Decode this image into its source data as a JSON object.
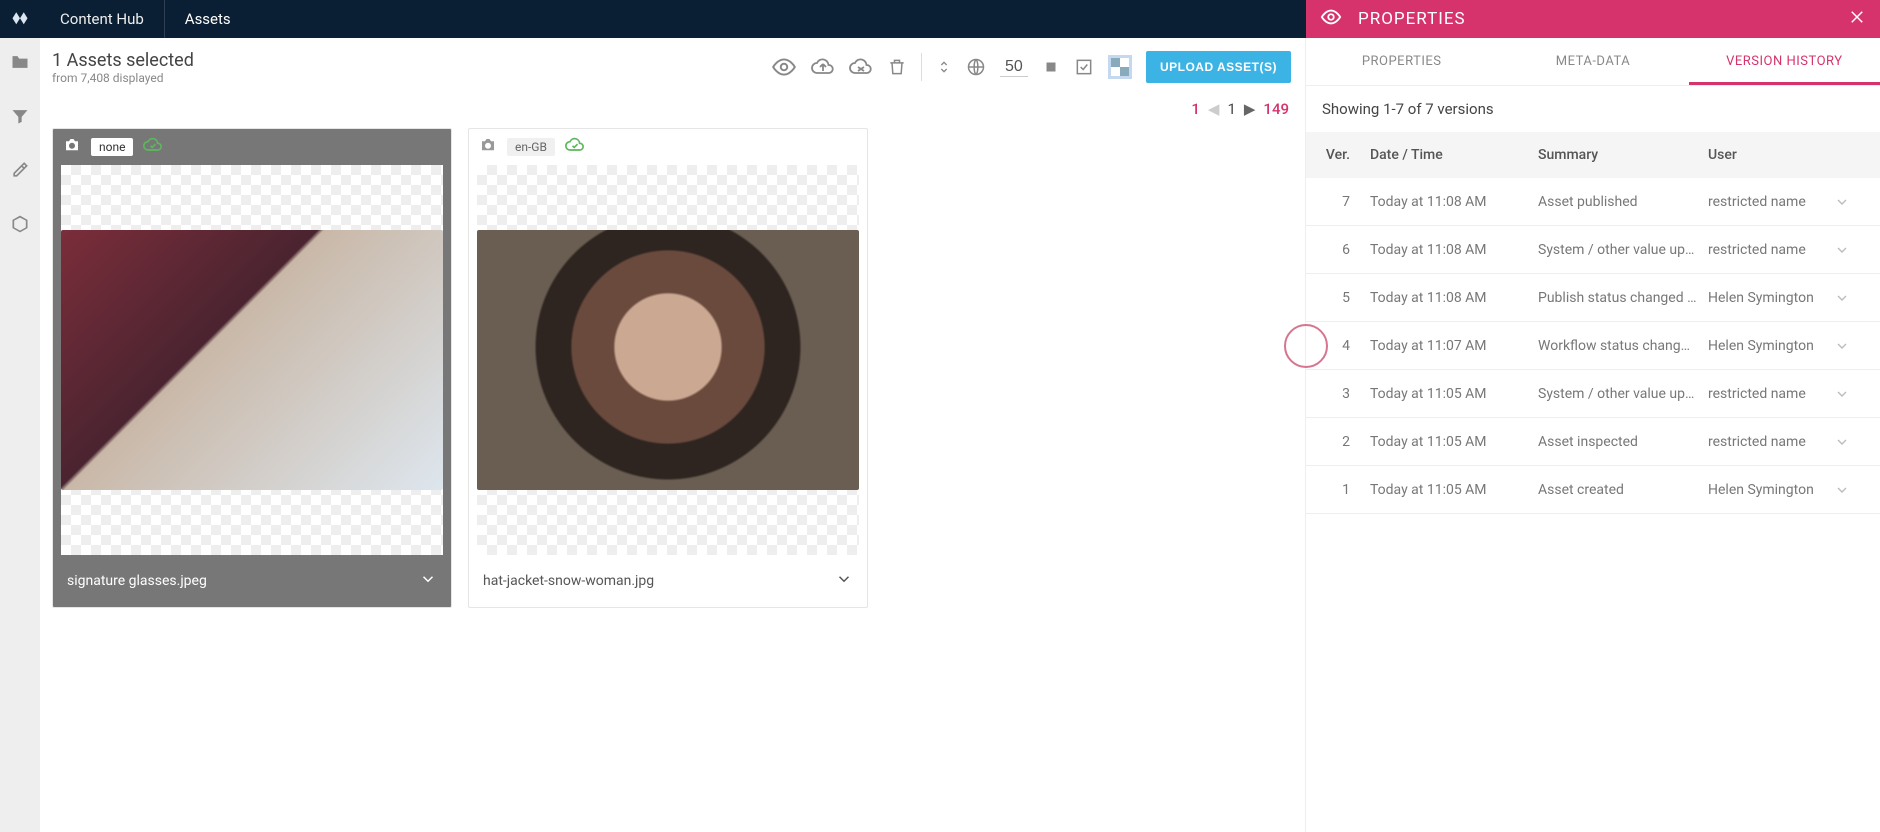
{
  "header": {
    "app_title": "Content Hub",
    "section": "Assets"
  },
  "selection": {
    "title": "1 Assets selected",
    "sub": "from 7,408 displayed"
  },
  "toolbar": {
    "page_size": "50",
    "upload_label": "UPLOAD ASSET(S)"
  },
  "pager": {
    "first": "1",
    "current": "1",
    "total": "149"
  },
  "assets": [
    {
      "locale": "none",
      "filename": "signature glasses.jpeg",
      "selected": true
    },
    {
      "locale": "en-GB",
      "filename": "hat-jacket-snow-woman.jpg",
      "selected": false
    }
  ],
  "props": {
    "title": "PROPERTIES",
    "tabs": [
      "PROPERTIES",
      "META-DATA",
      "VERSION HISTORY"
    ],
    "active_tab": 2,
    "versions_summary": "Showing 1-7 of 7 versions",
    "columns": {
      "ver": "Ver.",
      "dt": "Date / Time",
      "summary": "Summary",
      "user": "User"
    },
    "rows": [
      {
        "ver": "7",
        "dt": "Today at 11:08 AM",
        "summary": "Asset published",
        "user": "restricted name",
        "rollback": false
      },
      {
        "ver": "6",
        "dt": "Today at 11:08 AM",
        "summary": "System / other value up…",
        "user": "restricted name",
        "rollback": false
      },
      {
        "ver": "5",
        "dt": "Today at 11:08 AM",
        "summary": "Publish status changed …",
        "user": "Helen Symington",
        "rollback": false
      },
      {
        "ver": "4",
        "dt": "Today at 11:07 AM",
        "summary": "Workflow status chang…",
        "user": "Helen Symington",
        "rollback": true,
        "circled": true
      },
      {
        "ver": "3",
        "dt": "Today at 11:05 AM",
        "summary": "System / other value up…",
        "user": "restricted name",
        "rollback": false
      },
      {
        "ver": "2",
        "dt": "Today at 11:05 AM",
        "summary": "Asset inspected",
        "user": "restricted name",
        "rollback": false
      },
      {
        "ver": "1",
        "dt": "Today at 11:05 AM",
        "summary": "Asset created",
        "user": "Helen Symington",
        "rollback": true
      }
    ]
  }
}
